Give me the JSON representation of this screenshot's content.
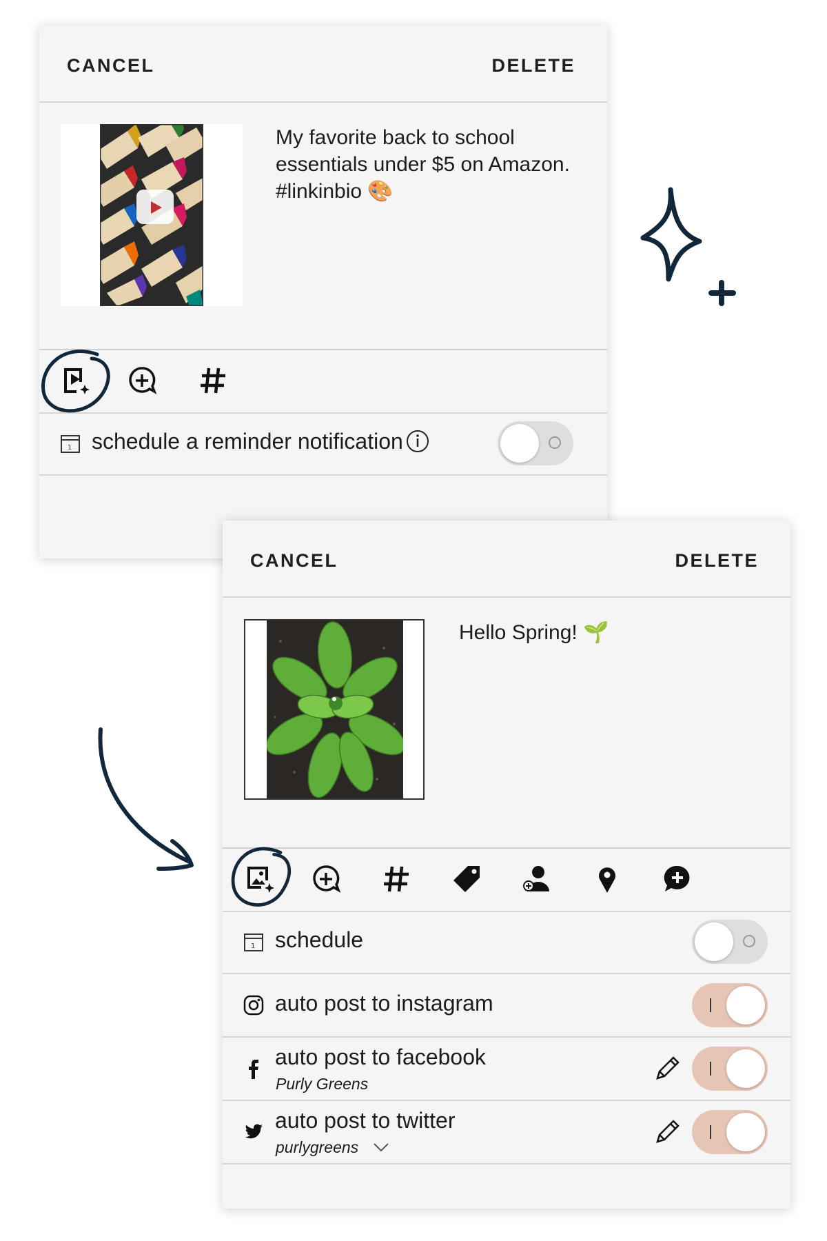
{
  "card1": {
    "cancel_label": "CANCEL",
    "delete_label": "DELETE",
    "caption_line1": "My favorite back to school",
    "caption_line2": "essentials under $5 on Amazon.",
    "caption_line3": "#linkinbio 🎨",
    "reminder_label": "schedule a reminder notification",
    "reminder_enabled": false,
    "toolbar_icons": [
      "reel-media-icon",
      "add-comment-icon",
      "hashtag-icon"
    ]
  },
  "card2": {
    "cancel_label": "CANCEL",
    "delete_label": "DELETE",
    "caption": "Hello Spring! 🌱",
    "toolbar_icons": [
      "image-media-icon",
      "add-comment-icon",
      "hashtag-icon",
      "tag-icon",
      "tag-user-icon",
      "location-icon",
      "add-message-icon"
    ],
    "rows": [
      {
        "label": "schedule",
        "enabled": false
      },
      {
        "label": "auto post to instagram",
        "enabled": true
      },
      {
        "label": "auto post to facebook",
        "account": "Purly Greens",
        "enabled": true
      },
      {
        "label": "auto post to twitter",
        "account": "purlygreens",
        "enabled": true
      }
    ]
  },
  "colors": {
    "card_bg": "#f5f5f5",
    "toggle_on": "#e6c5b5",
    "toggle_off": "#dedede",
    "doodle": "#12283a"
  }
}
